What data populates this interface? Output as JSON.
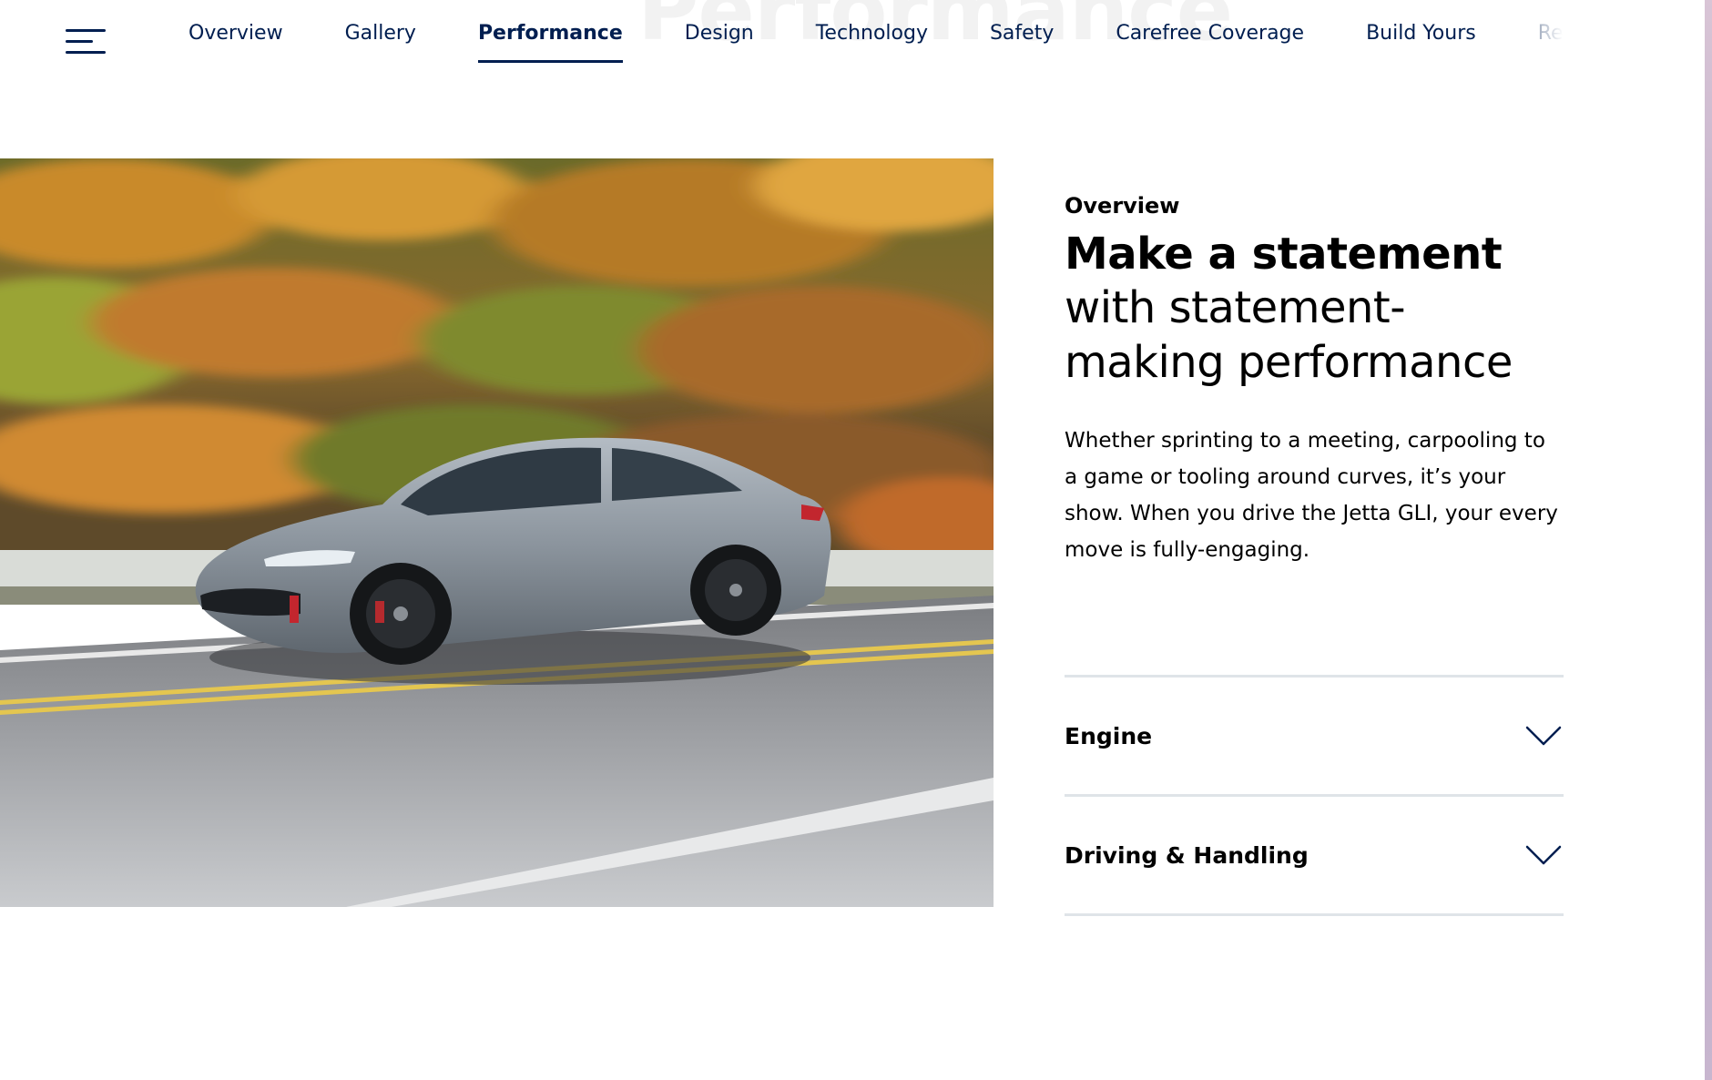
{
  "background_heading": "Performance",
  "nav": {
    "menu_icon": "hamburger-menu-icon",
    "items": [
      {
        "label": "Overview",
        "active": false
      },
      {
        "label": "Gallery",
        "active": false
      },
      {
        "label": "Performance",
        "active": true
      },
      {
        "label": "Design",
        "active": false
      },
      {
        "label": "Technology",
        "active": false
      },
      {
        "label": "Safety",
        "active": false
      },
      {
        "label": "Carefree Coverage",
        "active": false
      },
      {
        "label": "Build Yours",
        "active": false
      },
      {
        "label": "Request a",
        "active": false
      }
    ]
  },
  "hero": {
    "image_subject": "gray sedan driving on a road with autumn trees"
  },
  "content": {
    "eyebrow": "Overview",
    "headline_bold": "Make a statement",
    "headline_light": "with statement-making performance",
    "body": "Whether sprinting to a meeting, carpooling to a game or tooling around curves, it’s your show. When you drive the Jetta GLI, your every move is fully-engaging."
  },
  "accordion": {
    "items": [
      {
        "label": "Engine",
        "icon": "chevron-down-icon"
      },
      {
        "label": "Driving & Handling",
        "icon": "chevron-down-icon"
      }
    ]
  },
  "colors": {
    "nav_text": "#001e50",
    "divider": "#dfe4e8",
    "text": "#000000"
  }
}
